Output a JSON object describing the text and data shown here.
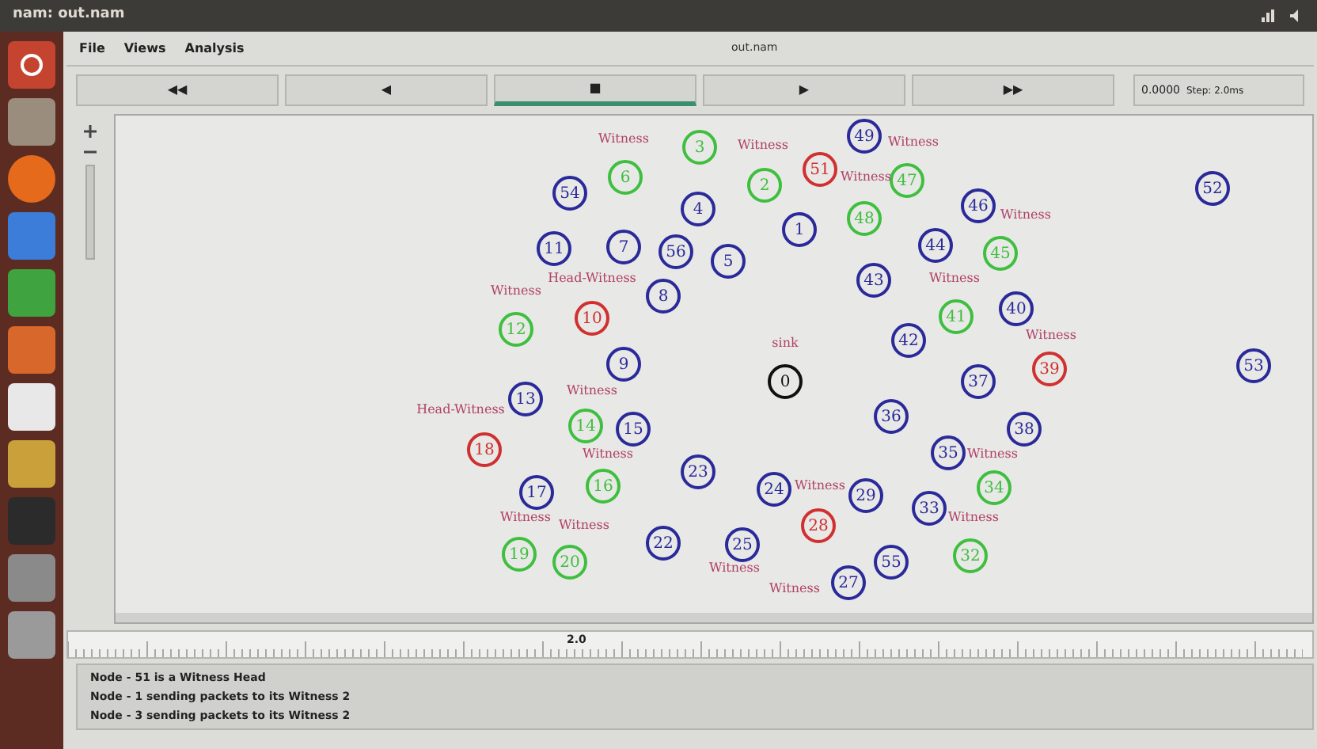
{
  "window": {
    "title": "nam: out.nam"
  },
  "menu": [
    "File",
    "Views",
    "Analysis"
  ],
  "file_name": "out.nam",
  "controls": [
    {
      "symbol": "◀◀",
      "selected": false
    },
    {
      "symbol": "◀",
      "selected": false
    },
    {
      "symbol": "■",
      "selected": true
    },
    {
      "symbol": "▶",
      "selected": false
    },
    {
      "symbol": "▶▶",
      "selected": false
    }
  ],
  "time": "0.0000",
  "step": "Step: 2.0ms",
  "nodes": [
    {
      "label": "3",
      "color": "#3fbf3f"
    },
    {
      "label": "49",
      "color": "#2a2a9a"
    },
    {
      "label": "54",
      "color": "#2a2a9a"
    },
    {
      "label": "6",
      "color": "#3fbf3f"
    },
    {
      "label": "2",
      "color": "#3fbf3f"
    },
    {
      "label": "51",
      "color": "#d03030"
    },
    {
      "label": "47",
      "color": "#3fbf3f"
    },
    {
      "label": "52",
      "color": "#2a2a9a"
    },
    {
      "label": "4",
      "color": "#2a2a9a"
    },
    {
      "label": "48",
      "color": "#3fbf3f"
    },
    {
      "label": "46",
      "color": "#2a2a9a"
    },
    {
      "label": "1",
      "color": "#2a2a9a"
    },
    {
      "label": "11",
      "color": "#2a2a9a"
    },
    {
      "label": "7",
      "color": "#2a2a9a"
    },
    {
      "label": "56",
      "color": "#2a2a9a"
    },
    {
      "label": "5",
      "color": "#2a2a9a"
    },
    {
      "label": "44",
      "color": "#2a2a9a"
    },
    {
      "label": "45",
      "color": "#3fbf3f"
    },
    {
      "label": "8",
      "color": "#2a2a9a"
    },
    {
      "label": "43",
      "color": "#2a2a9a"
    },
    {
      "label": "12",
      "color": "#3fbf3f"
    },
    {
      "label": "10",
      "color": "#d03030"
    },
    {
      "label": "42",
      "color": "#2a2a9a"
    },
    {
      "label": "41",
      "color": "#3fbf3f"
    },
    {
      "label": "40",
      "color": "#2a2a9a"
    },
    {
      "label": "9",
      "color": "#2a2a9a"
    },
    {
      "label": "0",
      "color": "#111111"
    },
    {
      "label": "37",
      "color": "#2a2a9a"
    },
    {
      "label": "39",
      "color": "#d03030"
    },
    {
      "label": "53",
      "color": "#2a2a9a"
    },
    {
      "label": "13",
      "color": "#2a2a9a"
    },
    {
      "label": "14",
      "color": "#3fbf3f"
    },
    {
      "label": "15",
      "color": "#2a2a9a"
    },
    {
      "label": "36",
      "color": "#2a2a9a"
    },
    {
      "label": "38",
      "color": "#2a2a9a"
    },
    {
      "label": "18",
      "color": "#d03030"
    },
    {
      "label": "23",
      "color": "#2a2a9a"
    },
    {
      "label": "35",
      "color": "#2a2a9a"
    },
    {
      "label": "17",
      "color": "#2a2a9a"
    },
    {
      "label": "16",
      "color": "#3fbf3f"
    },
    {
      "label": "24",
      "color": "#2a2a9a"
    },
    {
      "label": "29",
      "color": "#2a2a9a"
    },
    {
      "label": "33",
      "color": "#2a2a9a"
    },
    {
      "label": "34",
      "color": "#3fbf3f"
    },
    {
      "label": "19",
      "color": "#3fbf3f"
    },
    {
      "label": "20",
      "color": "#3fbf3f"
    },
    {
      "label": "22",
      "color": "#2a2a9a"
    },
    {
      "label": "25",
      "color": "#2a2a9a"
    },
    {
      "label": "28",
      "color": "#d03030"
    },
    {
      "label": "55",
      "color": "#2a2a9a"
    },
    {
      "label": "32",
      "color": "#3fbf3f"
    },
    {
      "label": "27",
      "color": "#2a2a9a"
    }
  ],
  "annotations": [
    "Witness",
    "Witness",
    "Witness",
    "Witness",
    "Witness",
    "Witness",
    "Head-Witness",
    "Witness",
    "sink",
    "Witness",
    "Witness",
    "Head-Witness",
    "Witness",
    "Witness",
    "Witness",
    "Witness",
    "Witness",
    "Witness",
    "Witness",
    "Witness"
  ],
  "timeline_label": "2.0",
  "messages": [
    "Node - 51 is a Witness Head",
    "Node - 1 sending packets to its Witness 2",
    "Node - 3 sending packets to its Witness 2"
  ]
}
